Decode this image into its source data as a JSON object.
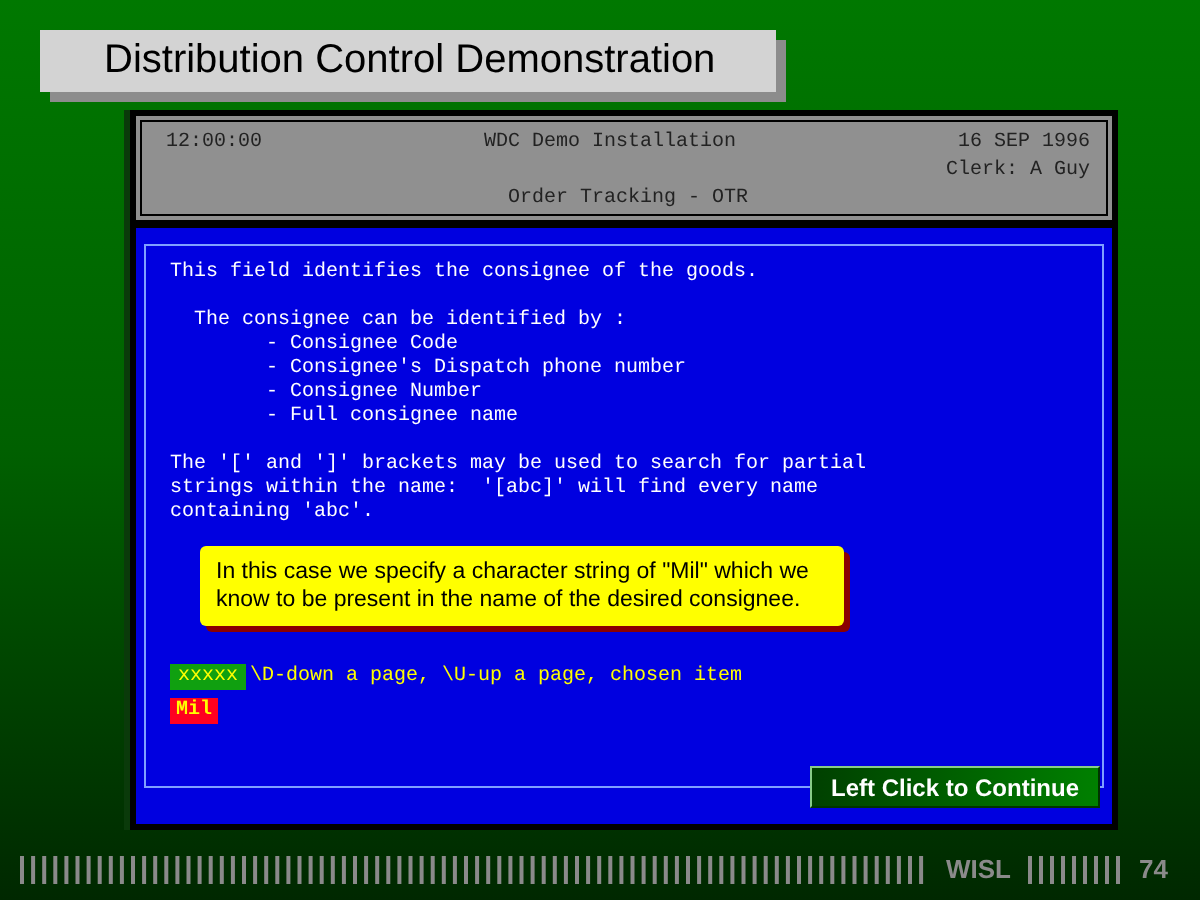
{
  "slide_title": "Distribution Control Demonstration",
  "terminal": {
    "header": {
      "time": "12:00:00",
      "system": "WDC Demo Installation",
      "date": "16 SEP 1996",
      "clerk": "Clerk: A Guy",
      "screen": "Order Tracking - OTR"
    },
    "intro": "This field identifies the consignee of the goods.",
    "list_title": "The consignee can be identified by :",
    "list_items": [
      "- Consignee Code",
      "- Consignee's Dispatch phone number",
      "- Consignee Number",
      "- Full consignee name"
    ],
    "note_lines": [
      "The '[' and ']' brackets may be used to search for partial",
      "strings within the name:  '[abc]' will find every name",
      "containing 'abc'."
    ],
    "callout": "In this case we specify a character string of \"Mil\" which we know to be present in the name of the desired consignee.",
    "input_mask": "xxxxx",
    "key_hint": "\\D-down a page, \\U-up a page, chosen item",
    "entry_value": "Mil"
  },
  "continue_button": "Left Click to Continue",
  "footer": {
    "brand": "WISL",
    "page": "74"
  }
}
